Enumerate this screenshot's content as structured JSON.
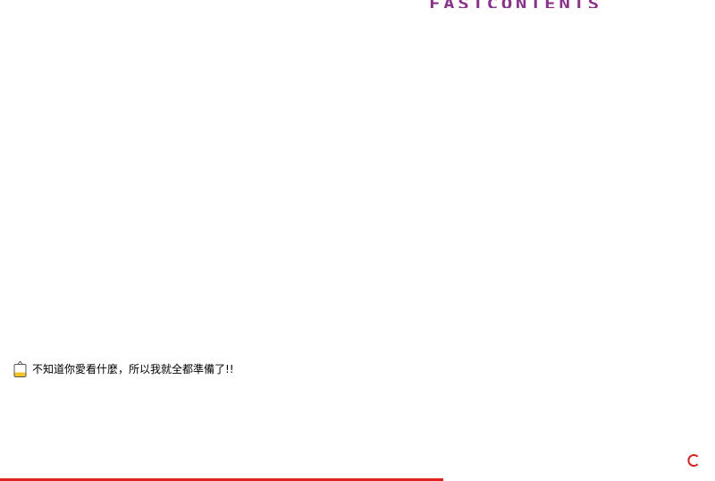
{
  "header": {
    "logo_text": "FASTCONTENTS",
    "logo_color": "#8e2f8f"
  },
  "tagline": {
    "icon": "shopping-bag-icon",
    "text": "不知道你愛看什麼，所以我就全都準備了!!"
  },
  "loading": {
    "progress": 0.62,
    "bar_color": "#e0201f",
    "spinner_icon": "loading-spinner-icon",
    "spinner_color": "#e0201f"
  }
}
